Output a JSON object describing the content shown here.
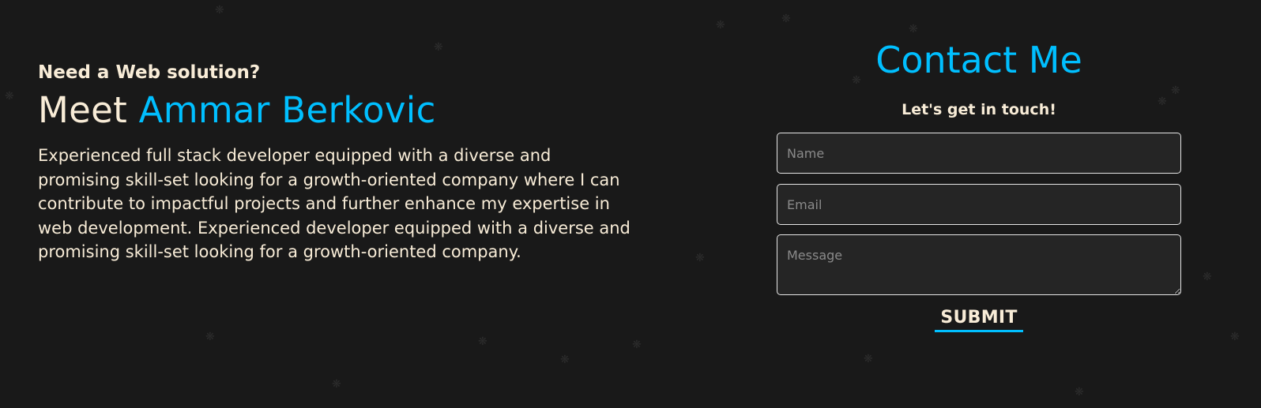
{
  "intro": {
    "kicker": "Need a Web solution?",
    "headline_prefix": "Meet",
    "headline_name": "Ammar Berkovic",
    "bio": "Experienced full stack developer equipped with a diverse and promising skill-set looking for a growth-oriented company where I can contribute to impactful projects and further enhance my expertise in web development. Experienced developer equipped with a diverse and promising skill-set looking for a growth-oriented company."
  },
  "contact": {
    "title": "Contact Me",
    "subtitle": "Let's get in touch!",
    "name_placeholder": "Name",
    "email_placeholder": "Email",
    "message_placeholder": "Message",
    "submit_label": "SUBMIT"
  },
  "colors": {
    "background": "#191919",
    "accent": "#00bfff",
    "text": "#f8ecd7"
  },
  "decor": {
    "particle_glyph": "❋"
  }
}
